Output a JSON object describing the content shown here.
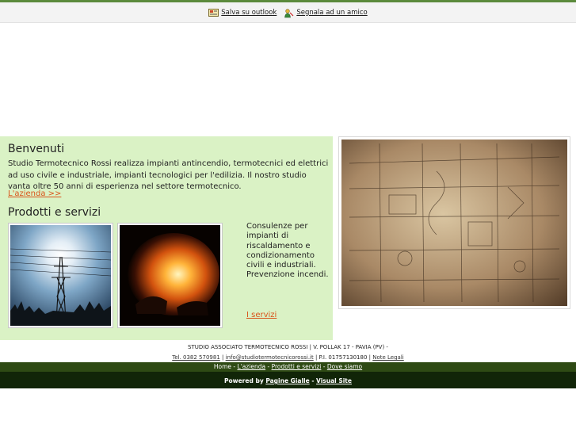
{
  "toolbar": {
    "save_label": "Salva su outlook",
    "share_label": "Segnala ad un amico"
  },
  "welcome": {
    "title": "Benvenuti",
    "text": "Studio Termotecnico Rossi realizza impianti antincendio, termotecnici ed elettrici ad uso civile e industriale, impianti tecnologici per l'edilizia. Il nostro studio vanta oltre 50 anni di esperienza nel settore termotecnico.",
    "link": "L'azienda >>"
  },
  "products": {
    "title": "Prodotti e servizi",
    "text": "Consulenze per impianti di riscaldamento e condizionamento civili e industriali. Prevenzione incendi.",
    "link": "I servizi"
  },
  "footer": {
    "company": "STUDIO ASSOCIATO TERMOTECNICO ROSSI | V. POLLAK 17 - PAVIA (PV) -",
    "tel": "Tel. 0382 570981",
    "email": "info@studiotermotecnicorossi.it",
    "vat": "| P.I. 01757130180 |",
    "legal": "Note Legali",
    "nav": {
      "home": "Home",
      "azienda": "L'azienda",
      "prodotti": "Prodotti e servizi",
      "dove": "Dove siamo"
    },
    "powered_by": "Powered by",
    "pagine_gialle": "Pagine Gialle",
    "visual_site": "Visual Site"
  },
  "colors": {
    "content_bg": "#daf2c5",
    "link": "#d9541a",
    "footer_nav_bg": "#2e4a14",
    "footer_bottom_bg": "#112508"
  }
}
